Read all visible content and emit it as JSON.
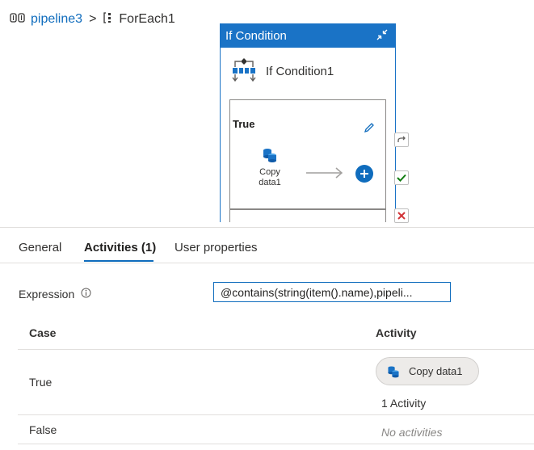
{
  "breadcrumb": {
    "pipeline": "pipeline3",
    "separator": ">",
    "current": "ForEach1"
  },
  "canvas": {
    "card_header": "If Condition",
    "activity_name": "If Condition1",
    "true_branch_label": "True",
    "copy_node_label_line1": "Copy",
    "copy_node_label_line2": "data1",
    "side_status_icons": [
      "skip-icon",
      "success-icon",
      "failure-icon"
    ]
  },
  "tabs": [
    {
      "label": "General"
    },
    {
      "label": "Activities (1)"
    },
    {
      "label": "User properties"
    }
  ],
  "expression": {
    "label": "Expression",
    "value": "@contains(string(item().name),pipeli..."
  },
  "table": {
    "headers": {
      "case": "Case",
      "activity": "Activity"
    },
    "rows": [
      {
        "case": "True",
        "activity_pill": "Copy data1",
        "activity_count": "1 Activity"
      },
      {
        "case": "False",
        "activity_empty": "No activities"
      }
    ]
  },
  "colors": {
    "accent": "#0f6cbd",
    "header": "#1a73c6",
    "success": "#107c10",
    "failure": "#d13438"
  }
}
